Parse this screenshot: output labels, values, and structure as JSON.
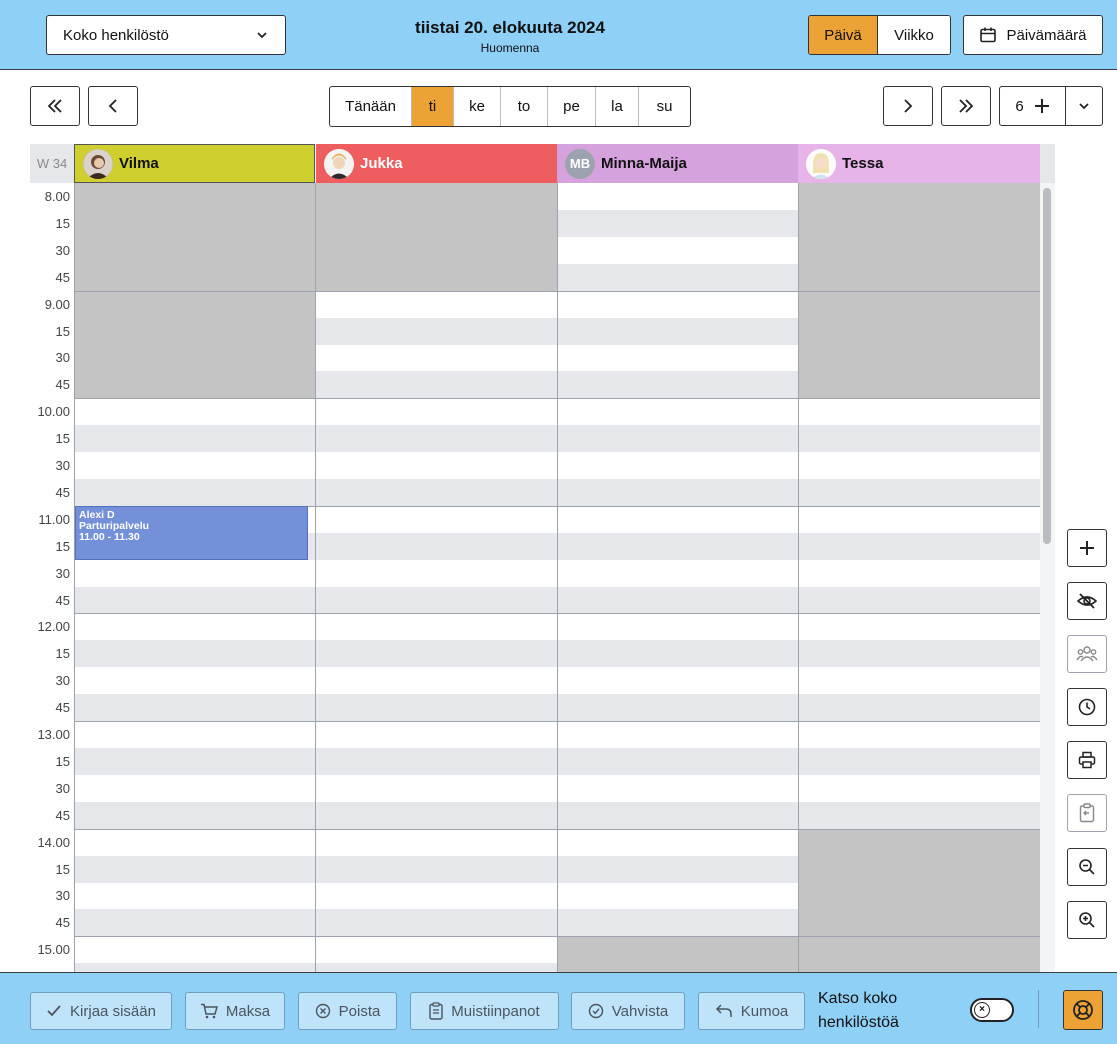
{
  "header": {
    "staff_select": {
      "value": "Koko henkilöstö"
    },
    "date_title": "tiistai 20. elokuuta 2024",
    "date_subtitle": "Huomenna",
    "view_day": "Päivä",
    "view_week": "Viikko",
    "date_picker_label": "Päivämäärä"
  },
  "nav": {
    "today_label": "Tänään",
    "days": [
      "ti",
      "ke",
      "to",
      "pe",
      "la",
      "su"
    ],
    "active_day": "ti",
    "count_value": "6"
  },
  "calendar": {
    "week_label": "W 34",
    "staff": [
      {
        "name": "Vilma",
        "color": "#cfd030",
        "avatar": "photo"
      },
      {
        "name": "Jukka",
        "color": "#ef5e5e",
        "avatar": "photo"
      },
      {
        "name": "Minna-Maija",
        "color": "#d6a2de",
        "avatar": "initials",
        "initials": "MB"
      },
      {
        "name": "Tessa",
        "color": "#e6b4e8",
        "avatar": "photo"
      }
    ],
    "time_labels": [
      "8.00",
      "15",
      "30",
      "45",
      "9.00",
      "15",
      "30",
      "45",
      "10.00",
      "15",
      "30",
      "45",
      "11.00",
      "15",
      "30",
      "45",
      "12.00",
      "15",
      "30",
      "45",
      "13.00",
      "15",
      "30",
      "45",
      "14.00",
      "15",
      "30",
      "45",
      "15.00",
      "15"
    ],
    "appointment": {
      "client": "Alexi D",
      "service": "Parturipalvelu",
      "time": "11.00 - 11.30"
    },
    "colors": {
      "blocked": "#c4c4c4",
      "alt_row": "#e5e7eb",
      "appointment": "#7390d9"
    }
  },
  "side_tools": [
    "plus-icon",
    "eye-off-icon",
    "group-icon",
    "clock-icon",
    "printer-icon",
    "clipboard-icon",
    "zoom-out-icon",
    "zoom-in-icon"
  ],
  "footer": {
    "checkin_label": "Kirjaa sisään",
    "pay_label": "Maksa",
    "delete_label": "Poista",
    "notes_label": "Muistiinpanot",
    "confirm_label": "Vahvista",
    "undo_label": "Kumoa",
    "show_all_line1": "Katso koko",
    "show_all_line2": "henkilöstöä",
    "toggle_state": "off"
  },
  "accent_colors": {
    "header_bg": "#8fd0f7",
    "active": "#eda235"
  }
}
